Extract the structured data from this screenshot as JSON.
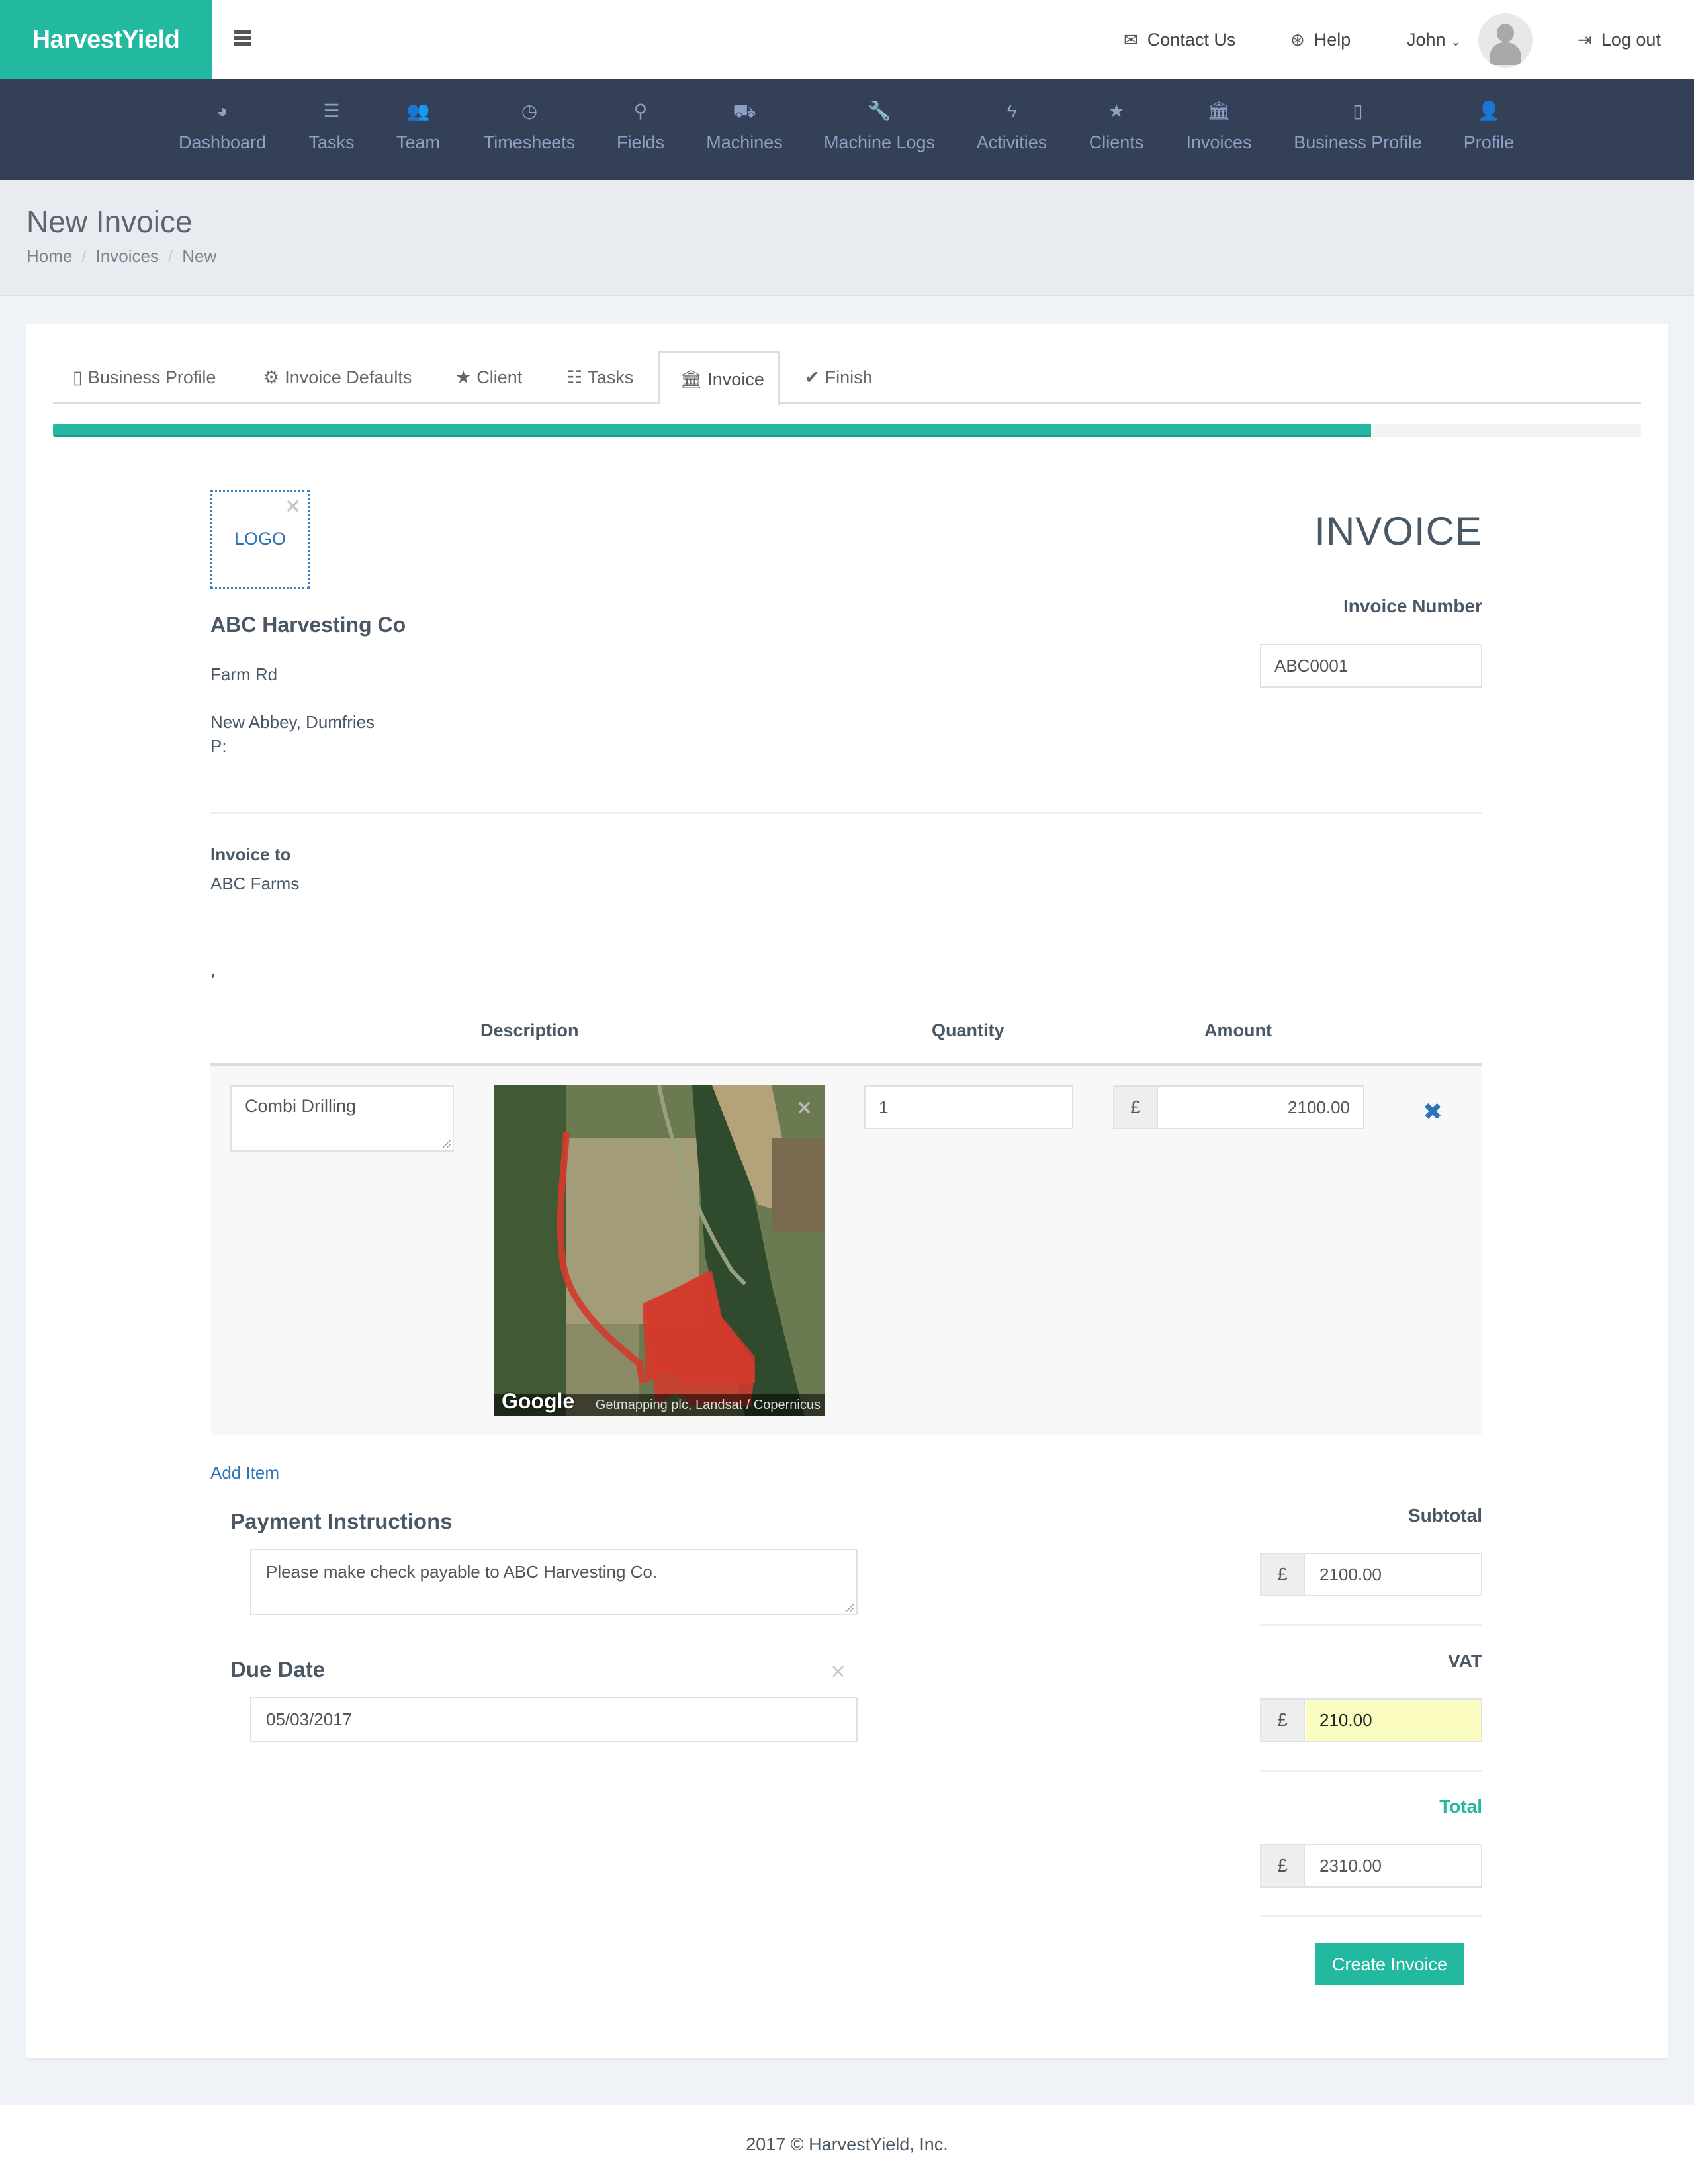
{
  "app": {
    "brand": "HarvestYield"
  },
  "topbar": {
    "menu_icon": "hamburger-icon",
    "contact": {
      "label": "Contact Us",
      "icon": "envelope-icon"
    },
    "help": {
      "label": "Help",
      "icon": "life-ring-icon"
    },
    "user": {
      "label": "John",
      "icon": "chevron-down-icon"
    },
    "avatar": "user-avatar",
    "logout": {
      "label": "Log out",
      "icon": "sign-out-icon"
    }
  },
  "mainnav": {
    "items": [
      {
        "label": "Dashboard",
        "icon": "dashboard-icon",
        "glyph": "◕"
      },
      {
        "label": "Tasks",
        "icon": "list-icon",
        "glyph": "☰"
      },
      {
        "label": "Team",
        "icon": "users-icon",
        "glyph": "👥"
      },
      {
        "label": "Timesheets",
        "icon": "clock-icon",
        "glyph": "◷"
      },
      {
        "label": "Fields",
        "icon": "map-marker-icon",
        "glyph": "⚲"
      },
      {
        "label": "Machines",
        "icon": "truck-icon",
        "glyph": "⛟"
      },
      {
        "label": "Machine Logs",
        "icon": "wrench-icon",
        "glyph": "🔧"
      },
      {
        "label": "Activities",
        "icon": "bolt-icon",
        "glyph": "ϟ"
      },
      {
        "label": "Clients",
        "icon": "star-icon",
        "glyph": "★"
      },
      {
        "label": "Invoices",
        "icon": "bank-icon",
        "glyph": "🏛"
      },
      {
        "label": "Business Profile",
        "icon": "building-icon",
        "glyph": "▯"
      },
      {
        "label": "Profile",
        "icon": "user-icon",
        "glyph": "👤"
      }
    ]
  },
  "page": {
    "title": "New Invoice",
    "breadcrumb": [
      "Home",
      "Invoices",
      "New"
    ]
  },
  "wizard": {
    "tabs": [
      {
        "label": "Business Profile",
        "icon": "building-icon",
        "glyph": "▯",
        "active": false
      },
      {
        "label": "Invoice Defaults",
        "icon": "cog-icon",
        "glyph": "⚙",
        "active": false
      },
      {
        "label": "Client",
        "icon": "star-icon",
        "glyph": "★",
        "active": false
      },
      {
        "label": "Tasks",
        "icon": "tasks-icon",
        "glyph": "☷",
        "active": false
      },
      {
        "label": "Invoice",
        "icon": "bank-icon",
        "glyph": "🏛",
        "active": true
      },
      {
        "label": "Finish",
        "icon": "check-icon",
        "glyph": "✔",
        "active": false
      }
    ],
    "progress_percent": 83,
    "progress_color": "#22b9a0"
  },
  "invoice": {
    "logo_label": "LOGO",
    "remove_glyph": "×",
    "business_name": "ABC Harvesting Co",
    "address_line1": "Farm Rd",
    "address_line2": "New Abbey, Dumfries",
    "phone_label": "P:",
    "title": "INVOICE",
    "number_label": "Invoice Number",
    "number_value": "ABC0001",
    "invoice_to_label": "Invoice to",
    "invoice_to_value": "ABC Farms",
    "invoice_to_extra": ",",
    "columns": {
      "description": "Description",
      "quantity": "Quantity",
      "amount": "Amount"
    },
    "items": [
      {
        "description": "Combi Drilling",
        "map_attribution": "Getmapping plc, Landsat / Copernicus",
        "map_logo": "Google",
        "quantity": "1",
        "currency": "£",
        "amount": "2100.00",
        "remove_glyph": "✖"
      }
    ],
    "add_item_label": "Add Item",
    "payment_instructions_label": "Payment Instructions",
    "payment_instructions_value": "Please make check payable to ABC Harvesting Co.",
    "due_date_label": "Due Date",
    "due_date_value": "05/03/2017",
    "due_date_clear": "×",
    "subtotal_label": "Subtotal",
    "subtotal_value": "2100.00",
    "vat_label": "VAT",
    "vat_value": "210.00",
    "total_label": "Total",
    "total_value": "2310.00",
    "currency": "£",
    "create_button": "Create Invoice"
  },
  "footer": {
    "text": "2017 © HarvestYield, Inc."
  },
  "colors": {
    "brand": "#22b9a0",
    "nav_bg": "#344058",
    "nav_text": "#8ea0c4",
    "link": "#2e74b5",
    "vat_highlight": "#fbfdc0"
  }
}
